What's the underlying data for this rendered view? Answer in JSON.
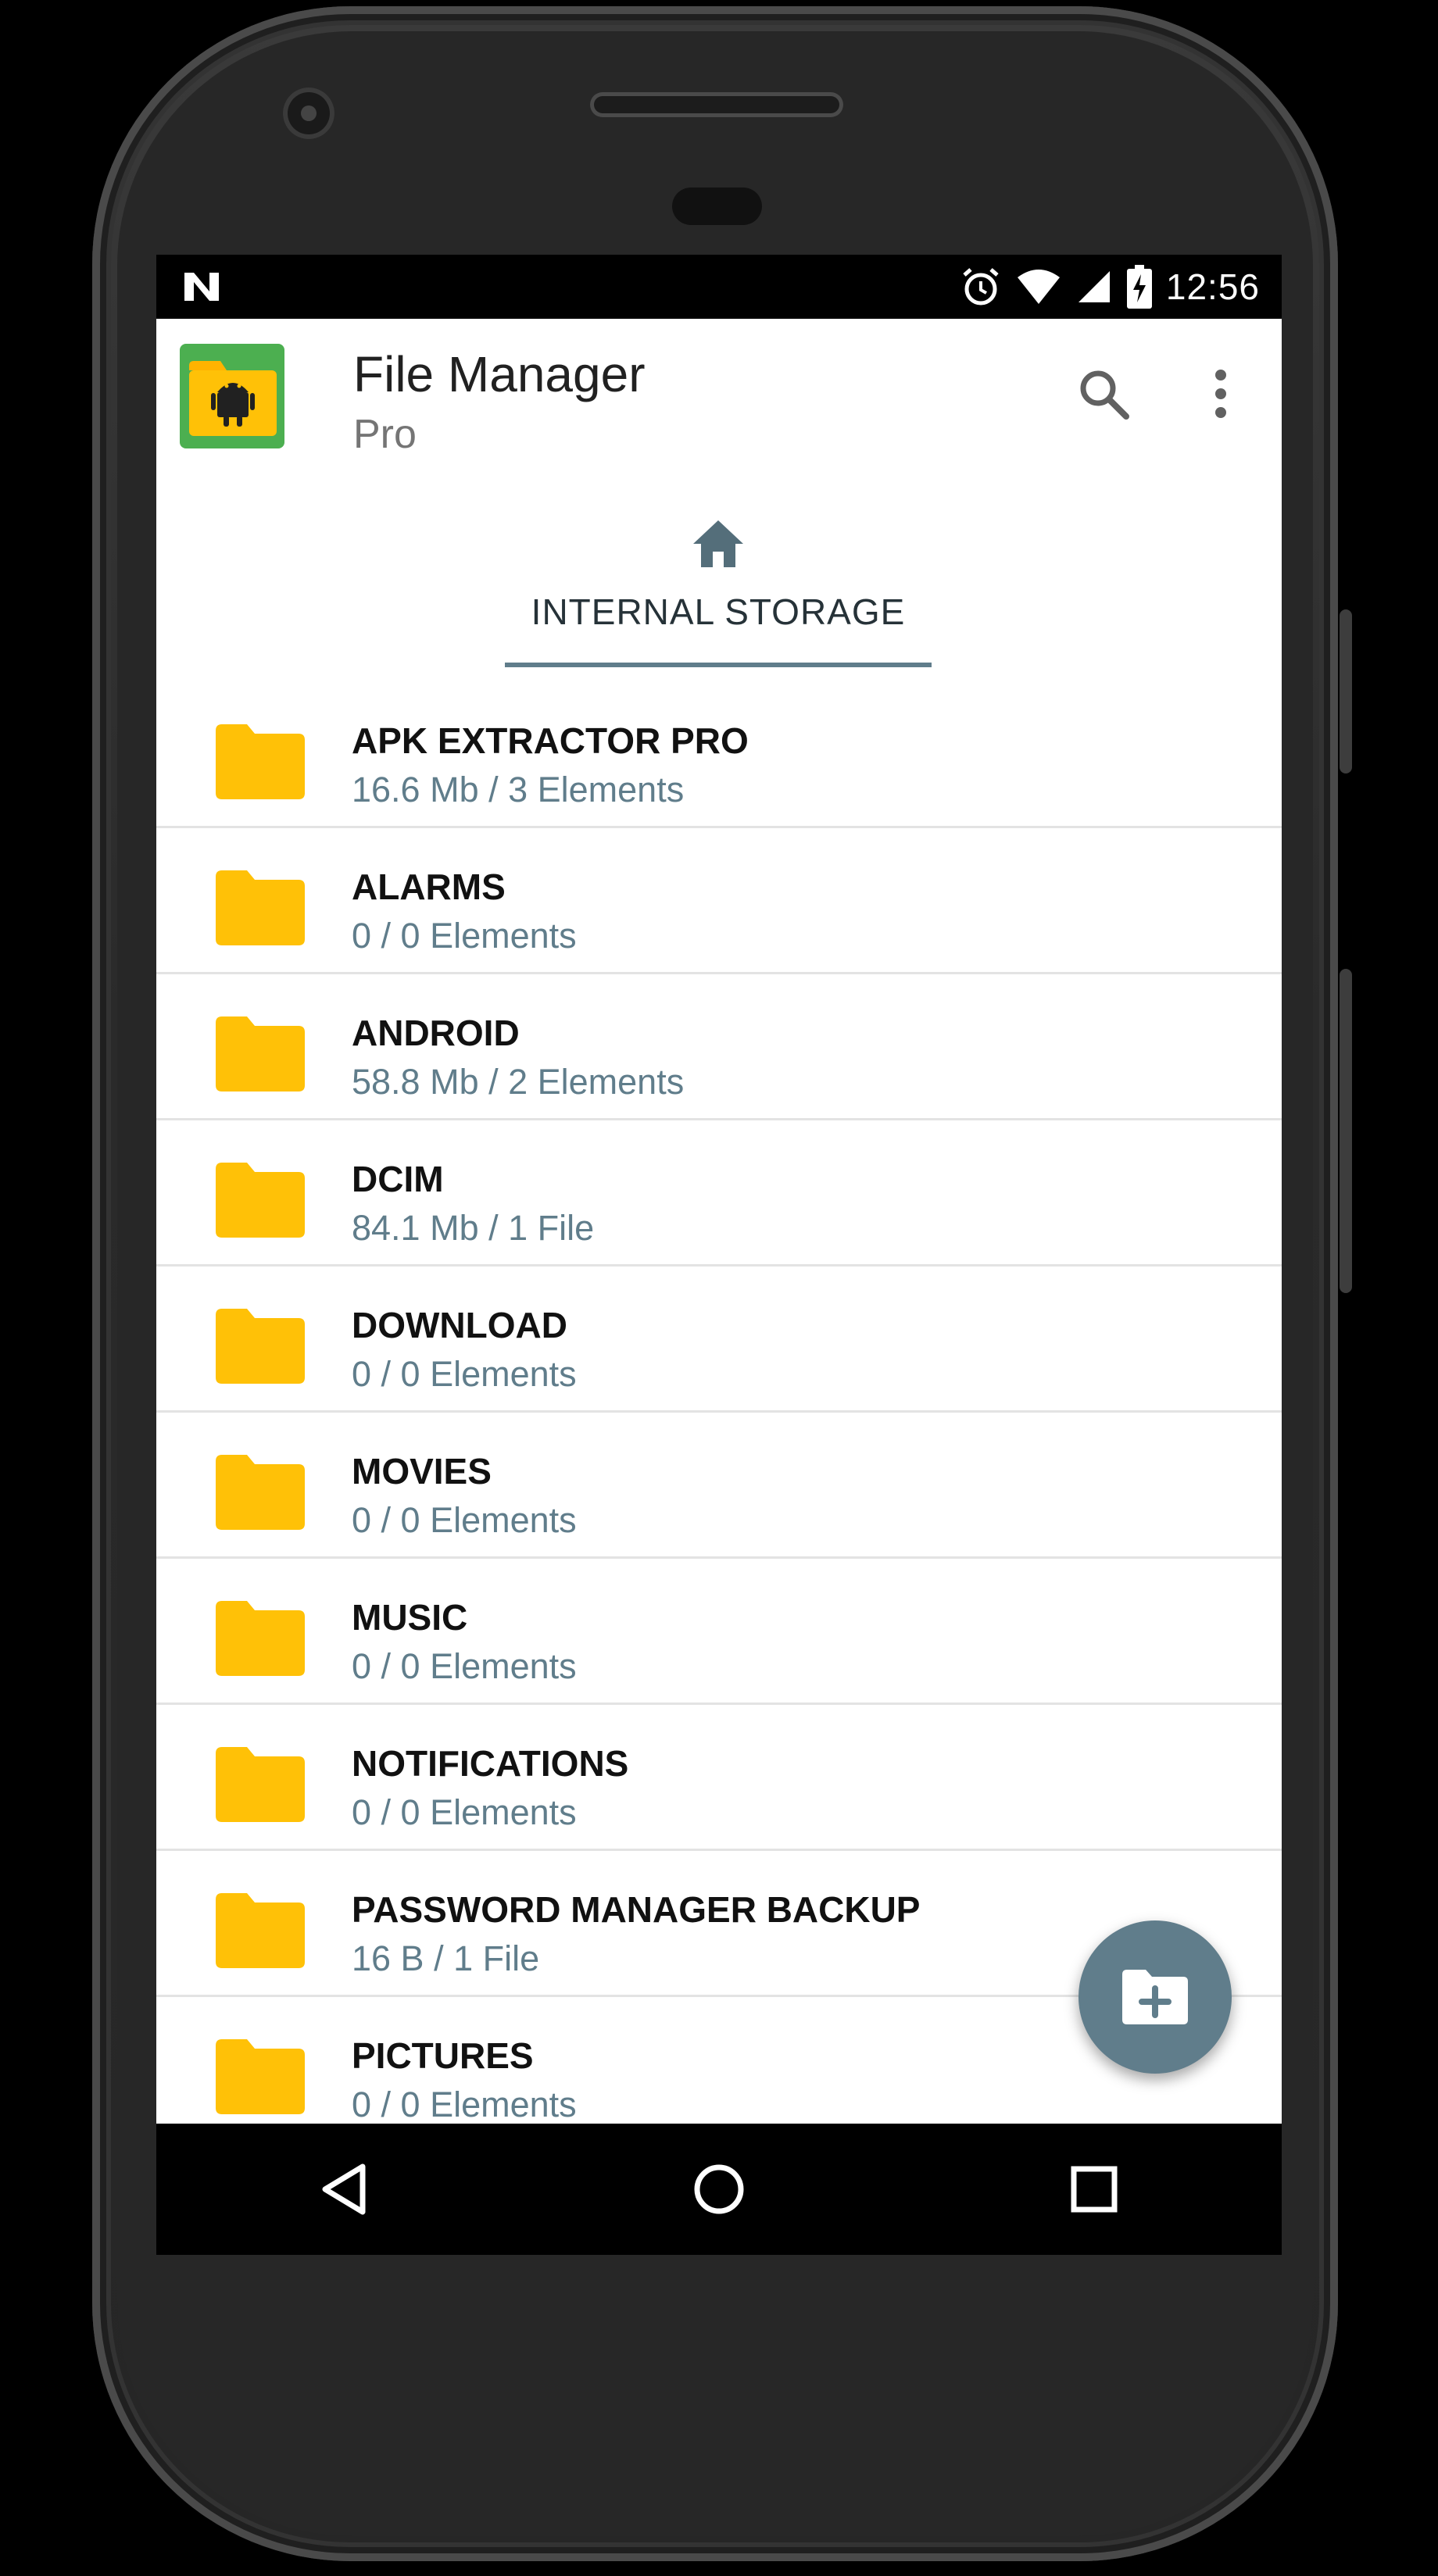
{
  "status_bar": {
    "time": "12:56",
    "icons": [
      "notification-n-icon",
      "alarm-icon",
      "wifi-icon",
      "signal-icon",
      "battery-charging-icon"
    ]
  },
  "app_bar": {
    "title": "File Manager",
    "subtitle": "Pro",
    "actions": [
      "search-icon",
      "more-vert-icon"
    ]
  },
  "tab": {
    "icon": "home-icon",
    "label": "INTERNAL STORAGE"
  },
  "files": [
    {
      "name": "APK EXTRACTOR PRO",
      "meta": "16.6 Mb / 3 Elements"
    },
    {
      "name": "ALARMS",
      "meta": "0 / 0 Elements"
    },
    {
      "name": "ANDROID",
      "meta": "58.8 Mb / 2 Elements"
    },
    {
      "name": "DCIM",
      "meta": "84.1 Mb / 1 File"
    },
    {
      "name": "DOWNLOAD",
      "meta": "0 / 0 Elements"
    },
    {
      "name": "MOVIES",
      "meta": "0 / 0 Elements"
    },
    {
      "name": "MUSIC",
      "meta": "0 / 0 Elements"
    },
    {
      "name": "NOTIFICATIONS",
      "meta": "0 / 0 Elements"
    },
    {
      "name": "PASSWORD MANAGER BACKUP",
      "meta": "16 B / 1 File"
    },
    {
      "name": "PICTURES",
      "meta": "0 / 0 Elements"
    }
  ],
  "fab": {
    "icon": "create-folder-icon"
  },
  "nav_bar": {
    "buttons": [
      "back-icon",
      "home-circle-icon",
      "recents-icon"
    ]
  },
  "colors": {
    "accent": "#607d8b",
    "folder": "#ffc107",
    "title_text": "#212121",
    "meta_text": "#607d8b"
  }
}
